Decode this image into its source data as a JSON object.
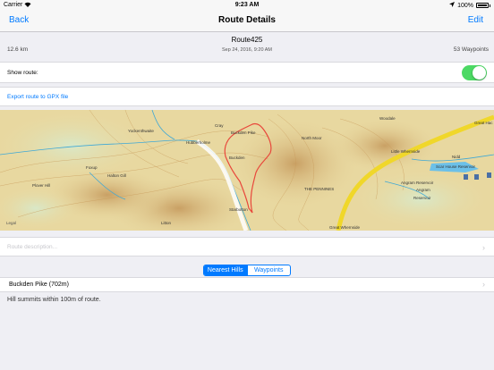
{
  "status_bar": {
    "carrier": "Carrier",
    "time": "9:23 AM",
    "battery": "100%"
  },
  "nav": {
    "back_label": "Back",
    "title": "Route Details",
    "edit_label": "Edit"
  },
  "route": {
    "name": "Route425",
    "date": "Sep 24, 2016, 9:20 AM",
    "distance": "12.6 km",
    "waypoints": "53 Waypoints"
  },
  "show_route": {
    "label": "Show route:",
    "enabled": true
  },
  "export": {
    "label": "Export route to GPX file"
  },
  "map": {
    "labels": {
      "cray": "Cray",
      "buckden_pike": "Buckden Pike",
      "north_moor": "North Moor",
      "buckden": "Buckden",
      "hubberholme": "Hubberholme",
      "yockenthwaite": "Yockenthwaite",
      "halton_gill": "Halton Gill",
      "foxup": "Foxup",
      "plover_hill": "Plover Hill",
      "starbotton": "Starbotton",
      "the_pennines": "THE PENNINES",
      "little_whernside": "Little Whernside",
      "scar_house_reservoir": "Scar House Reservoir",
      "angram_reservoir": "Angram Reservoir",
      "angram": "Angram",
      "reservoir": "Reservoir",
      "great_whernside": "Great Whernside",
      "woodale": "Woodale",
      "great_haw": "Great Hac",
      "litton": "Litton",
      "legal": "Legal",
      "nidd": "Nidd"
    },
    "colors": {
      "route": "#e8473b",
      "highway": "#f0d72a",
      "water": "#3fa8d6"
    }
  },
  "description": {
    "placeholder": "Route description..."
  },
  "segmented": {
    "options": [
      "Nearest Hills",
      "Waypoints"
    ],
    "selected": "Nearest Hills"
  },
  "hills": [
    {
      "label": "Buckden Pike (702m)"
    }
  ],
  "hint": "Hill summits within 100m of route."
}
